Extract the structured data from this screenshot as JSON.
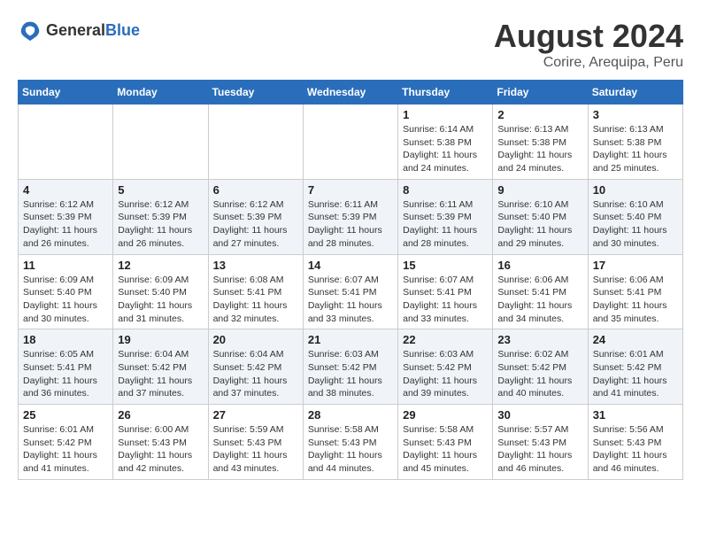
{
  "header": {
    "logo_general": "General",
    "logo_blue": "Blue",
    "month": "August 2024",
    "location": "Corire, Arequipa, Peru"
  },
  "days_of_week": [
    "Sunday",
    "Monday",
    "Tuesday",
    "Wednesday",
    "Thursday",
    "Friday",
    "Saturday"
  ],
  "weeks": [
    {
      "days": [
        {
          "date": "",
          "info": ""
        },
        {
          "date": "",
          "info": ""
        },
        {
          "date": "",
          "info": ""
        },
        {
          "date": "",
          "info": ""
        },
        {
          "date": "1",
          "info": "Sunrise: 6:14 AM\nSunset: 5:38 PM\nDaylight: 11 hours and 24 minutes."
        },
        {
          "date": "2",
          "info": "Sunrise: 6:13 AM\nSunset: 5:38 PM\nDaylight: 11 hours and 24 minutes."
        },
        {
          "date": "3",
          "info": "Sunrise: 6:13 AM\nSunset: 5:38 PM\nDaylight: 11 hours and 25 minutes."
        }
      ]
    },
    {
      "days": [
        {
          "date": "4",
          "info": "Sunrise: 6:12 AM\nSunset: 5:39 PM\nDaylight: 11 hours and 26 minutes."
        },
        {
          "date": "5",
          "info": "Sunrise: 6:12 AM\nSunset: 5:39 PM\nDaylight: 11 hours and 26 minutes."
        },
        {
          "date": "6",
          "info": "Sunrise: 6:12 AM\nSunset: 5:39 PM\nDaylight: 11 hours and 27 minutes."
        },
        {
          "date": "7",
          "info": "Sunrise: 6:11 AM\nSunset: 5:39 PM\nDaylight: 11 hours and 28 minutes."
        },
        {
          "date": "8",
          "info": "Sunrise: 6:11 AM\nSunset: 5:39 PM\nDaylight: 11 hours and 28 minutes."
        },
        {
          "date": "9",
          "info": "Sunrise: 6:10 AM\nSunset: 5:40 PM\nDaylight: 11 hours and 29 minutes."
        },
        {
          "date": "10",
          "info": "Sunrise: 6:10 AM\nSunset: 5:40 PM\nDaylight: 11 hours and 30 minutes."
        }
      ]
    },
    {
      "days": [
        {
          "date": "11",
          "info": "Sunrise: 6:09 AM\nSunset: 5:40 PM\nDaylight: 11 hours and 30 minutes."
        },
        {
          "date": "12",
          "info": "Sunrise: 6:09 AM\nSunset: 5:40 PM\nDaylight: 11 hours and 31 minutes."
        },
        {
          "date": "13",
          "info": "Sunrise: 6:08 AM\nSunset: 5:41 PM\nDaylight: 11 hours and 32 minutes."
        },
        {
          "date": "14",
          "info": "Sunrise: 6:07 AM\nSunset: 5:41 PM\nDaylight: 11 hours and 33 minutes."
        },
        {
          "date": "15",
          "info": "Sunrise: 6:07 AM\nSunset: 5:41 PM\nDaylight: 11 hours and 33 minutes."
        },
        {
          "date": "16",
          "info": "Sunrise: 6:06 AM\nSunset: 5:41 PM\nDaylight: 11 hours and 34 minutes."
        },
        {
          "date": "17",
          "info": "Sunrise: 6:06 AM\nSunset: 5:41 PM\nDaylight: 11 hours and 35 minutes."
        }
      ]
    },
    {
      "days": [
        {
          "date": "18",
          "info": "Sunrise: 6:05 AM\nSunset: 5:41 PM\nDaylight: 11 hours and 36 minutes."
        },
        {
          "date": "19",
          "info": "Sunrise: 6:04 AM\nSunset: 5:42 PM\nDaylight: 11 hours and 37 minutes."
        },
        {
          "date": "20",
          "info": "Sunrise: 6:04 AM\nSunset: 5:42 PM\nDaylight: 11 hours and 37 minutes."
        },
        {
          "date": "21",
          "info": "Sunrise: 6:03 AM\nSunset: 5:42 PM\nDaylight: 11 hours and 38 minutes."
        },
        {
          "date": "22",
          "info": "Sunrise: 6:03 AM\nSunset: 5:42 PM\nDaylight: 11 hours and 39 minutes."
        },
        {
          "date": "23",
          "info": "Sunrise: 6:02 AM\nSunset: 5:42 PM\nDaylight: 11 hours and 40 minutes."
        },
        {
          "date": "24",
          "info": "Sunrise: 6:01 AM\nSunset: 5:42 PM\nDaylight: 11 hours and 41 minutes."
        }
      ]
    },
    {
      "days": [
        {
          "date": "25",
          "info": "Sunrise: 6:01 AM\nSunset: 5:42 PM\nDaylight: 11 hours and 41 minutes."
        },
        {
          "date": "26",
          "info": "Sunrise: 6:00 AM\nSunset: 5:43 PM\nDaylight: 11 hours and 42 minutes."
        },
        {
          "date": "27",
          "info": "Sunrise: 5:59 AM\nSunset: 5:43 PM\nDaylight: 11 hours and 43 minutes."
        },
        {
          "date": "28",
          "info": "Sunrise: 5:58 AM\nSunset: 5:43 PM\nDaylight: 11 hours and 44 minutes."
        },
        {
          "date": "29",
          "info": "Sunrise: 5:58 AM\nSunset: 5:43 PM\nDaylight: 11 hours and 45 minutes."
        },
        {
          "date": "30",
          "info": "Sunrise: 5:57 AM\nSunset: 5:43 PM\nDaylight: 11 hours and 46 minutes."
        },
        {
          "date": "31",
          "info": "Sunrise: 5:56 AM\nSunset: 5:43 PM\nDaylight: 11 hours and 46 minutes."
        }
      ]
    }
  ]
}
